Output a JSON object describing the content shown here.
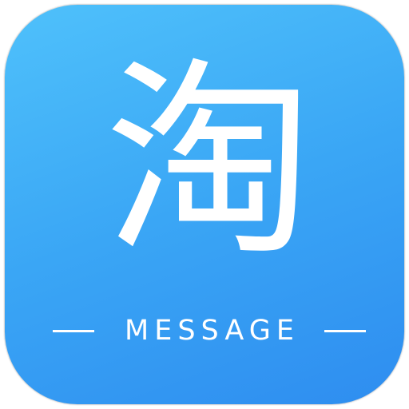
{
  "icon": {
    "glyph": "淘",
    "tagline": "MESSAGE",
    "colors": {
      "gradient_start": "#4fc1fb",
      "gradient_end": "#2e8df0",
      "foreground": "#ffffff"
    }
  }
}
